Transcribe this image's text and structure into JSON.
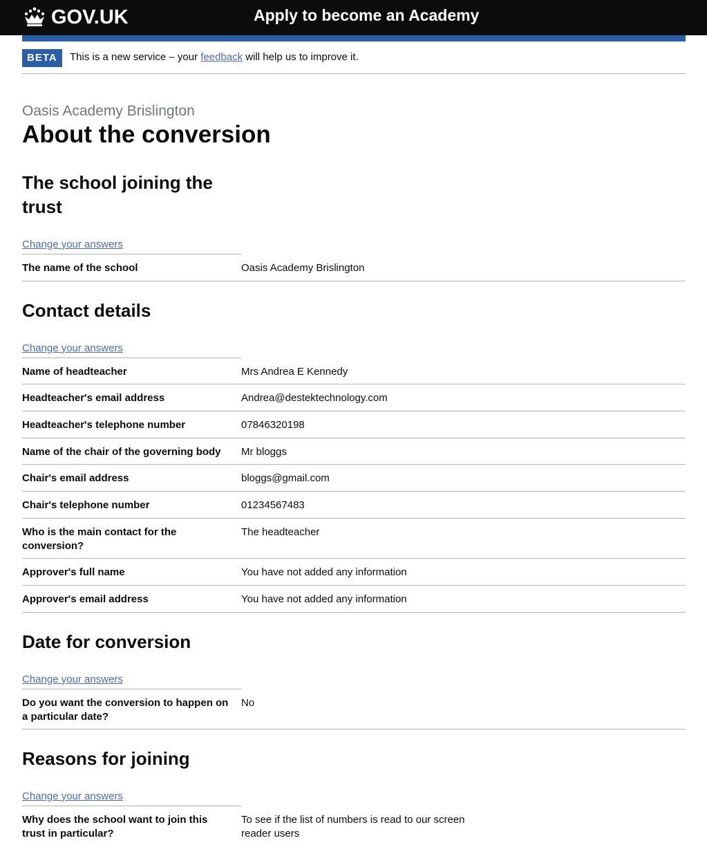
{
  "header": {
    "logo_text": "GOV.UK",
    "service_name": "Apply to become an Academy"
  },
  "phase": {
    "tag": "BETA",
    "text_before": "This is a new service – your ",
    "link_text": "feedback",
    "text_after": " will help us to improve it."
  },
  "page": {
    "caption": "Oasis Academy Brislington",
    "title": "About the conversion"
  },
  "sections": [
    {
      "heading": "The school joining the trust",
      "change_link": "Change your answers",
      "rows": [
        {
          "key": "The name of the school",
          "value": "Oasis Academy Brislington"
        }
      ]
    },
    {
      "heading": "Contact details",
      "change_link": "Change your answers",
      "rows": [
        {
          "key": "Name of headteacher",
          "value": "Mrs Andrea E Kennedy"
        },
        {
          "key": "Headteacher's email address",
          "value": "Andrea@destektechnology.com"
        },
        {
          "key": "Headteacher's telephone number",
          "value": "07846320198"
        },
        {
          "key": "Name of the chair of the governing body",
          "value": "Mr bloggs"
        },
        {
          "key": "Chair's email address",
          "value": "bloggs@gmail.com"
        },
        {
          "key": "Chair's telephone number",
          "value": "01234567483"
        },
        {
          "key": "Who is the main contact for the conversion?",
          "value": "The headteacher"
        },
        {
          "key": "Approver's full name",
          "value": "You have not added any information"
        },
        {
          "key": "Approver's email address",
          "value": "You have not added any information"
        }
      ]
    },
    {
      "heading": "Date for conversion",
      "change_link": "Change your answers",
      "rows": [
        {
          "key": "Do you want the conversion to happen on a particular date?",
          "value": "No"
        }
      ]
    },
    {
      "heading": "Reasons for joining",
      "change_link": "Change your answers",
      "rows": [
        {
          "key": "Why does the school want to join this trust in particular?",
          "value": "To see if the list of numbers is read to our screen reader users"
        }
      ]
    }
  ],
  "icons": {
    "logo": "crown-icon"
  }
}
